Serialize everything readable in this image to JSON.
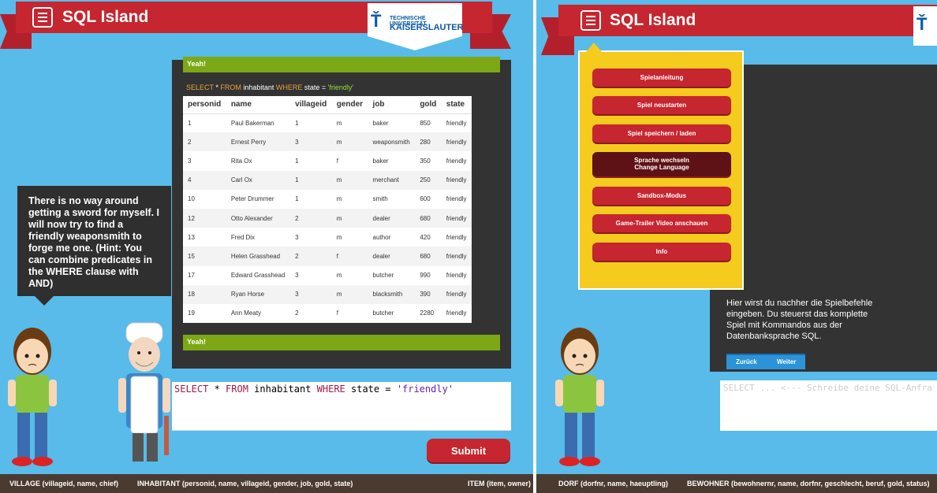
{
  "left": {
    "app_title": "SQL Island",
    "logo": {
      "line1": "TECHNISCHE UNIVERSITÄT",
      "line2": "KAISERSLAUTERN"
    },
    "speech": "There is no way around getting a sword for myself. I will now try to find a friendly weaponsmith to forge me one. (Hint: You can combine predicates in the WHERE clause with AND)",
    "yeah_top": "Yeah!",
    "yeah_bottom": "Yeah!",
    "query_echo": {
      "kw1": "SELECT",
      "star": " * ",
      "kw2": "FROM",
      "table": " inhabitant ",
      "kw3": "WHERE",
      "cond": " state = ",
      "value": "'friendly'"
    },
    "table": {
      "columns": [
        "personid",
        "name",
        "villageid",
        "gender",
        "job",
        "gold",
        "state"
      ],
      "rows": [
        [
          "1",
          "Paul Bakerman",
          "1",
          "m",
          "baker",
          "850",
          "friendly"
        ],
        [
          "2",
          "Ernest Perry",
          "3",
          "m",
          "weaponsmith",
          "280",
          "friendly"
        ],
        [
          "3",
          "Rita Ox",
          "1",
          "f",
          "baker",
          "350",
          "friendly"
        ],
        [
          "4",
          "Carl Ox",
          "1",
          "m",
          "merchant",
          "250",
          "friendly"
        ],
        [
          "10",
          "Peter Drummer",
          "1",
          "m",
          "smith",
          "600",
          "friendly"
        ],
        [
          "12",
          "Otto Alexander",
          "2",
          "m",
          "dealer",
          "680",
          "friendly"
        ],
        [
          "13",
          "Fred Dix",
          "3",
          "m",
          "author",
          "420",
          "friendly"
        ],
        [
          "15",
          "Helen Grasshead",
          "2",
          "f",
          "dealer",
          "680",
          "friendly"
        ],
        [
          "17",
          "Edward Grasshead",
          "3",
          "m",
          "butcher",
          "990",
          "friendly"
        ],
        [
          "18",
          "Ryan Horse",
          "3",
          "m",
          "blacksmith",
          "390",
          "friendly"
        ],
        [
          "19",
          "Ann Meaty",
          "2",
          "f",
          "butcher",
          "2280",
          "friendly"
        ]
      ]
    },
    "editor": {
      "kw1": "SELECT",
      "p1": " * ",
      "kw2": "FROM",
      "p2": " inhabitant ",
      "kw3": "WHERE",
      "p3": " state = ",
      "str": "'friendly'"
    },
    "submit_label": "Submit",
    "footer": {
      "village": "VILLAGE (villageid, name, chief)",
      "inhabitant": "INHABITANT (personid, name, villageid, gender, job, gold, state)",
      "item": "ITEM (item, owner)"
    }
  },
  "right": {
    "app_title": "SQL Island",
    "menu": [
      "Spielanleitung",
      "Spiel neustarten",
      "Spiel speichern / laden",
      "Sprache wechseln",
      "Sandbox-Modus",
      "Game-Trailer Video anschauen",
      "Info"
    ],
    "menu_active_sub": "Change Language",
    "tutorial_text": "Hier wirst du nachher die Spielbefehle eingeben. Du steuerst das komplette Spiel mit Kommandos aus der Datenbanksprache SQL.",
    "back_label": "Zurück",
    "next_label": "Weiter",
    "editor_placeholder": "SELECT ... <--- Schreibe deine SQL-Anfra",
    "footer": {
      "dorf": "DORF (dorfnr, name, haeuptling)",
      "bewohner": "BEWOHNER (bewohnernr, name, dorfnr, geschlecht, beruf, gold, status)"
    }
  },
  "colors": {
    "sky": "#58bbe9",
    "banner": "#c6262f",
    "panel": "#333333",
    "success": "#7ba814",
    "menu_bg": "#f5cb1e",
    "footer": "#4b3a30"
  }
}
